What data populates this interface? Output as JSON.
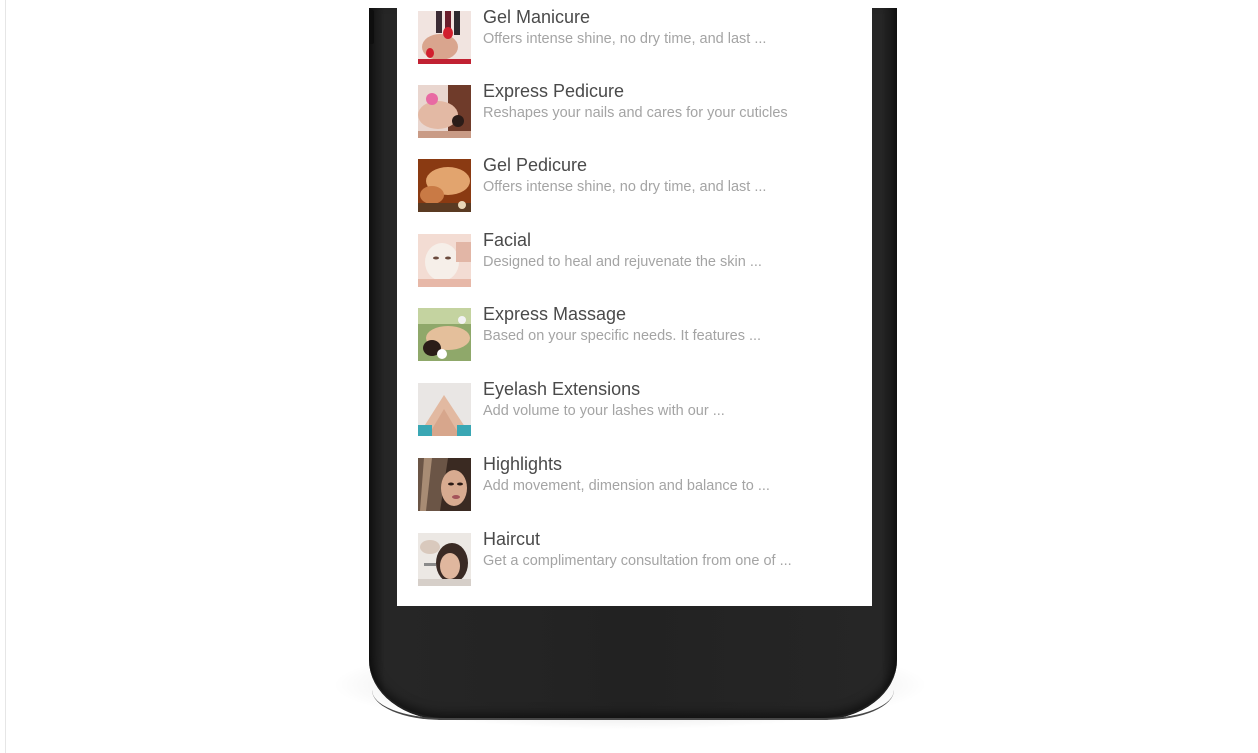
{
  "services": [
    {
      "title": "Gel Manicure",
      "description": "Offers intense shine, no dry time, and last ...",
      "thumbnail_icon": "gel-manicure-photo-icon"
    },
    {
      "title": "Express Pedicure",
      "description": "Reshapes your nails and cares for your cuticles",
      "thumbnail_icon": "express-pedicure-photo-icon"
    },
    {
      "title": "Gel Pedicure",
      "description": "Offers intense shine, no dry time, and last ...",
      "thumbnail_icon": "gel-pedicure-photo-icon"
    },
    {
      "title": "Facial",
      "description": "Designed to heal and rejuvenate the skin ...",
      "thumbnail_icon": "facial-photo-icon"
    },
    {
      "title": "Express Massage",
      "description": "Based on your specific needs. It features ...",
      "thumbnail_icon": "express-massage-photo-icon"
    },
    {
      "title": "Eyelash Extensions",
      "description": "Add volume to your lashes with our ...",
      "thumbnail_icon": "eyelash-extensions-photo-icon"
    },
    {
      "title": "Highlights",
      "description": "Add movement, dimension and balance to ...",
      "thumbnail_icon": "highlights-photo-icon"
    },
    {
      "title": "Haircut",
      "description": "Get a complimentary  consultation from one of ...",
      "thumbnail_icon": "haircut-photo-icon"
    }
  ],
  "colors": {
    "title_text": "#4a4a4a",
    "description_text": "#a4a4a4",
    "screen_background": "#ffffff",
    "phone_body": "#222222"
  }
}
